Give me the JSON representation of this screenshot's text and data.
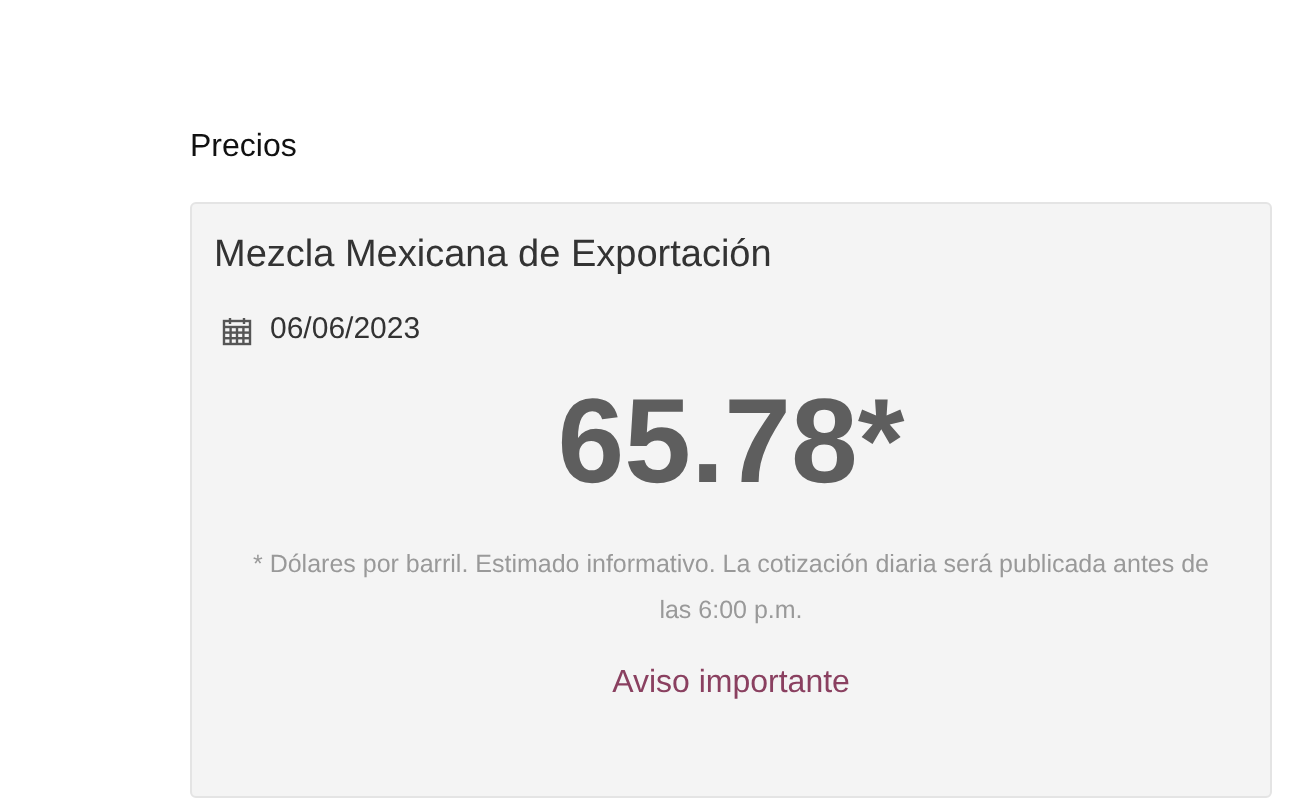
{
  "section": {
    "title": "Precios"
  },
  "card": {
    "title": "Mezcla Mexicana de Exportación",
    "date": "06/06/2023",
    "price": "65.78*",
    "note": "* Dólares por barril. Estimado informativo. La cotización diaria será publicada antes de las 6:00 p.m.",
    "link": "Aviso importante"
  }
}
